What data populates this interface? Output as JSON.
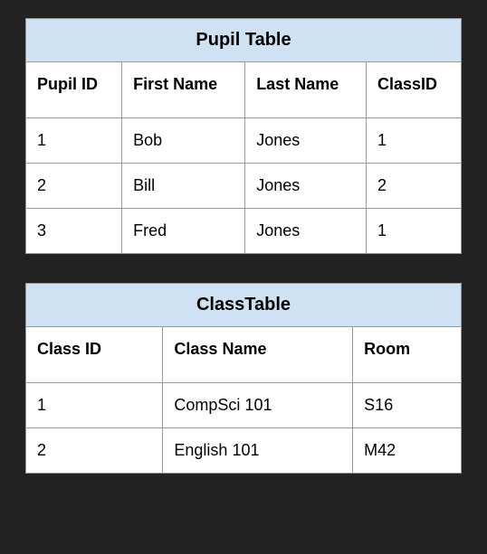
{
  "tables": [
    {
      "title": "Pupil Table",
      "headers": [
        "Pupil ID",
        "First Name",
        "Last Name",
        "ClassID"
      ],
      "rows": [
        [
          "1",
          "Bob",
          "Jones",
          "1"
        ],
        [
          "2",
          "Bill",
          "Jones",
          "2"
        ],
        [
          "3",
          "Fred",
          "Jones",
          "1"
        ]
      ]
    },
    {
      "title": "ClassTable",
      "headers": [
        "Class ID",
        "Class Name",
        "Room"
      ],
      "rows": [
        [
          "1",
          "CompSci 101",
          "S16"
        ],
        [
          "2",
          "English 101",
          "M42"
        ]
      ]
    }
  ]
}
